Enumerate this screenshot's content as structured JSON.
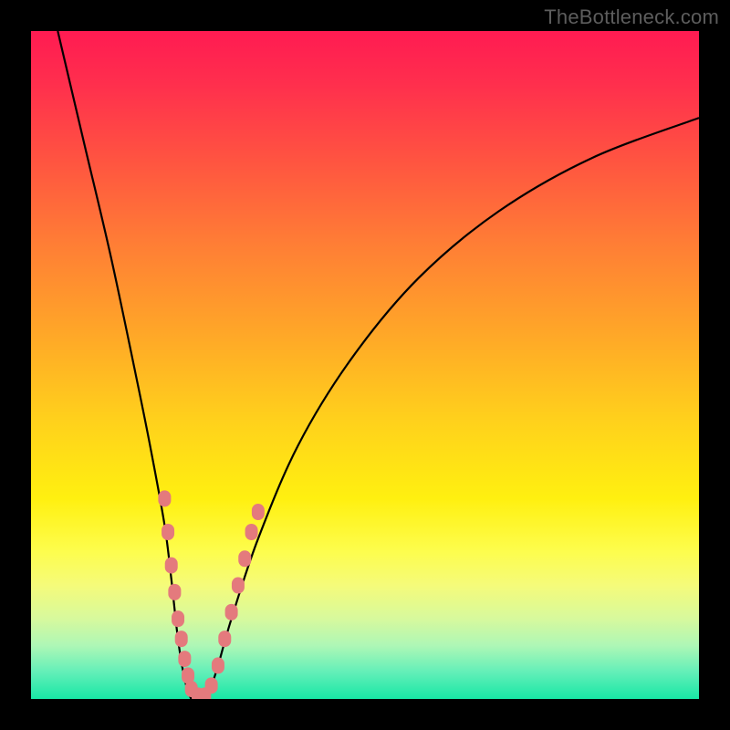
{
  "watermark": "TheBottleneck.com",
  "chart_data": {
    "type": "line",
    "title": "",
    "xlabel": "",
    "ylabel": "",
    "xlim": [
      0,
      100
    ],
    "ylim": [
      0,
      100
    ],
    "grid": false,
    "series": [
      {
        "name": "bottleneck-curve",
        "color": "#000000",
        "x": [
          4,
          8,
          12,
          16,
          18,
          20,
          21,
          22,
          23,
          24,
          25,
          26,
          27,
          28,
          30,
          34,
          40,
          48,
          58,
          70,
          84,
          100
        ],
        "y": [
          100,
          83,
          66,
          47,
          37,
          26,
          18,
          9,
          3,
          0,
          0,
          0,
          2,
          5,
          12,
          24,
          38,
          51,
          63,
          73,
          81,
          87
        ]
      }
    ],
    "markers": [
      {
        "name": "cluster-points",
        "color": "#e47a7d",
        "shape": "rounded-rect",
        "points": [
          {
            "x": 20.0,
            "y": 30.0
          },
          {
            "x": 20.5,
            "y": 25.0
          },
          {
            "x": 21.0,
            "y": 20.0
          },
          {
            "x": 21.5,
            "y": 16.0
          },
          {
            "x": 22.0,
            "y": 12.0
          },
          {
            "x": 22.5,
            "y": 9.0
          },
          {
            "x": 23.0,
            "y": 6.0
          },
          {
            "x": 23.5,
            "y": 3.5
          },
          {
            "x": 24.0,
            "y": 1.5
          },
          {
            "x": 25.0,
            "y": 0.5
          },
          {
            "x": 26.0,
            "y": 0.5
          },
          {
            "x": 27.0,
            "y": 2.0
          },
          {
            "x": 28.0,
            "y": 5.0
          },
          {
            "x": 29.0,
            "y": 9.0
          },
          {
            "x": 30.0,
            "y": 13.0
          },
          {
            "x": 31.0,
            "y": 17.0
          },
          {
            "x": 32.0,
            "y": 21.0
          },
          {
            "x": 33.0,
            "y": 25.0
          },
          {
            "x": 34.0,
            "y": 28.0
          }
        ]
      }
    ]
  }
}
